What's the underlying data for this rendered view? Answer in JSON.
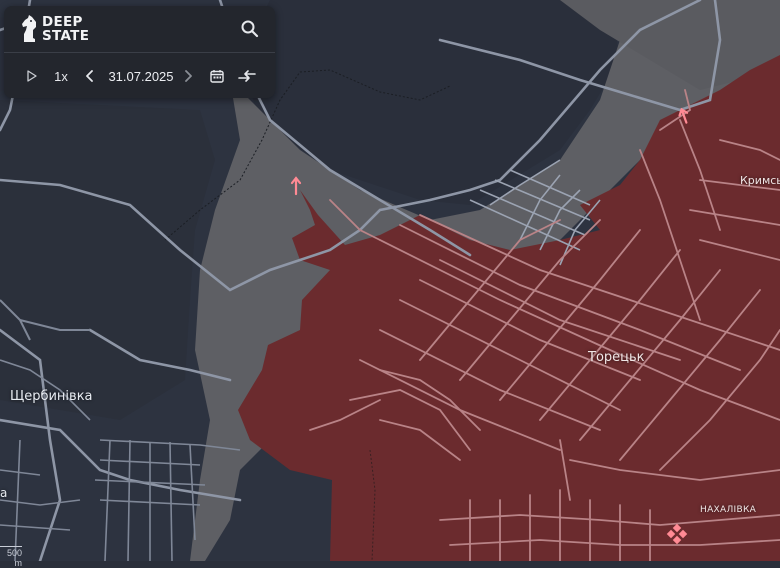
{
  "app": {
    "logo_line1": "DEEP",
    "logo_line2": "STATE"
  },
  "toolbar": {
    "speed": "1x",
    "date": "31.07.2025"
  },
  "map_labels": {
    "toretsk": "Торецьк",
    "shcherbynivka": "Щербинівка",
    "krymske": "Кримсь",
    "nakhalivka": "НАХАЛІВКА",
    "edge_fragment": "а"
  },
  "scale": {
    "label": "500 m"
  },
  "colors": {
    "background": "#2a2f3a",
    "dark_zone": "#2d3340",
    "grey_zone": "#5e5f64",
    "occupied_zone": "#6b2b2e",
    "roads": "#8e96a6",
    "roads_occupied": "#b98387",
    "marker": "#ff8a94",
    "panel": "#23262d"
  },
  "icons": {
    "search": "search-icon",
    "play": "play-icon",
    "prev": "chevron-left-icon",
    "next": "chevron-right-icon",
    "calendar": "calendar-icon",
    "compare": "compare-arrows-icon",
    "logo": "knight-icon",
    "arrow": "direction-arrow-icon",
    "diamond": "diamond-marker-icon"
  }
}
